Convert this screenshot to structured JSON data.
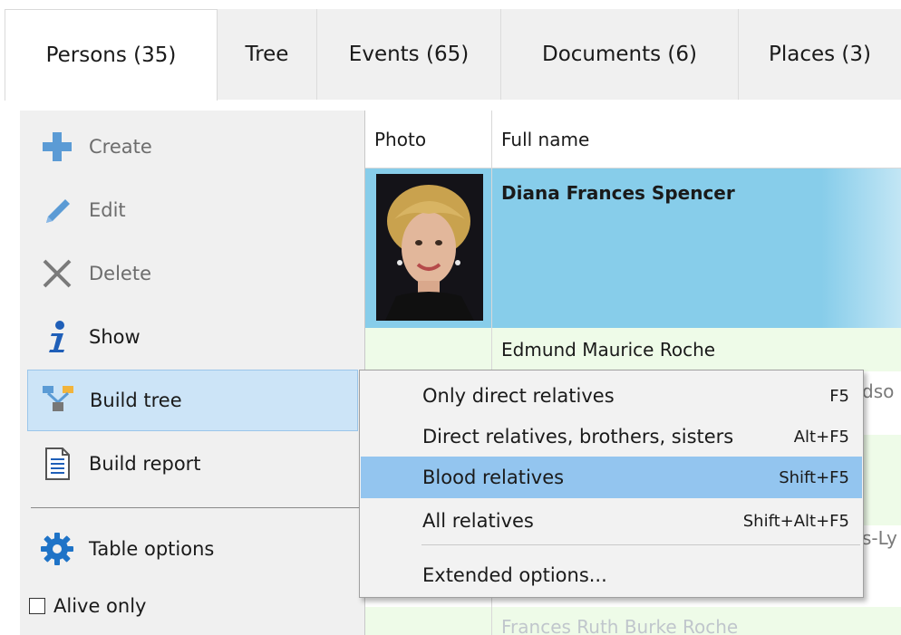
{
  "tabs": [
    {
      "label": "Persons (35)"
    },
    {
      "label": "Tree"
    },
    {
      "label": "Events (65)"
    },
    {
      "label": "Documents (6)"
    },
    {
      "label": "Places (3)"
    }
  ],
  "sidebar": {
    "create_label": "Create",
    "edit_label": "Edit",
    "delete_label": "Delete",
    "show_label": "Show",
    "build_tree_label": "Build tree",
    "build_report_label": "Build report",
    "table_options_label": "Table options",
    "alive_only_label": "Alive only"
  },
  "grid": {
    "headers": {
      "photo": "Photo",
      "full_name": "Full name"
    },
    "rows": [
      {
        "full_name": "Diana Frances Spencer",
        "selected": true
      },
      {
        "full_name": "Edmund Maurice Roche"
      },
      {
        "full_name": "Frances Ruth Burke Roche"
      }
    ],
    "partial_texts": [
      "dso",
      "s-Ly"
    ]
  },
  "context_menu": {
    "items": [
      {
        "label": "Only direct relatives",
        "shortcut": "F5"
      },
      {
        "label": "Direct relatives, brothers, sisters",
        "shortcut": "Alt+F5"
      },
      {
        "label": "Blood relatives",
        "shortcut": "Shift+F5",
        "highlighted": true
      },
      {
        "label": "All relatives",
        "shortcut": "Shift+Alt+F5"
      },
      {
        "label": "Extended options...",
        "shortcut": ""
      }
    ]
  },
  "colors": {
    "selection_blue": "#87cdea",
    "menu_highlight": "#93c5ef",
    "sidebar_selected": "#cce4f7",
    "row_green": "#eefbe8"
  }
}
